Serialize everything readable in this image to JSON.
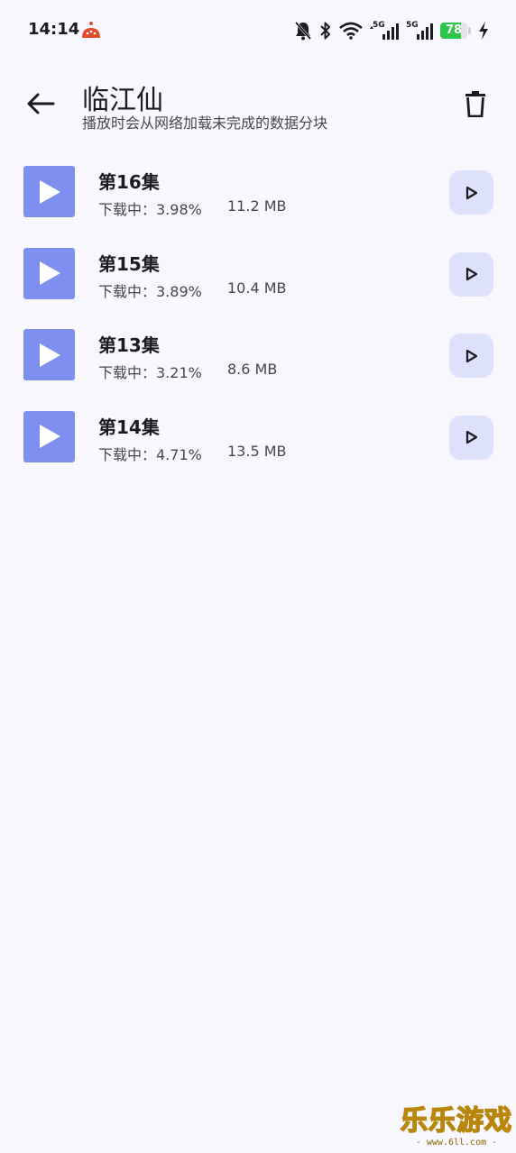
{
  "status_bar": {
    "time": "14:14",
    "battery_level": "78",
    "battery_fraction": 0.78,
    "battery_color": "#2cc64a",
    "icons": [
      "mute-bell-icon",
      "bluetooth-icon",
      "wifi-icon",
      "5g-signal-icon",
      "5g-signal-icon",
      "charging-icon"
    ],
    "network_labels": [
      "5G",
      "5G"
    ]
  },
  "header": {
    "title": "临江仙",
    "subtitle": "播放时会从网络加载未完成的数据分块",
    "back_icon": "arrow-left-icon",
    "delete_icon": "trash-icon"
  },
  "accent_colors": {
    "thumbnail": "#7d8fef",
    "play_button_bg": "#dde1fb",
    "background": "#f8f7fe"
  },
  "episodes": [
    {
      "title": "第16集",
      "status": "下载中：3.98%",
      "size": "11.2 MB"
    },
    {
      "title": "第15集",
      "status": "下载中：3.89%",
      "size": "10.4 MB"
    },
    {
      "title": "第13集",
      "status": "下载中：3.21%",
      "size": "8.6 MB"
    },
    {
      "title": "第14集",
      "status": "下载中：4.71%",
      "size": "13.5 MB"
    }
  ],
  "watermark": {
    "main": "乐乐游戏",
    "sub": "- www.6ll.com -"
  }
}
